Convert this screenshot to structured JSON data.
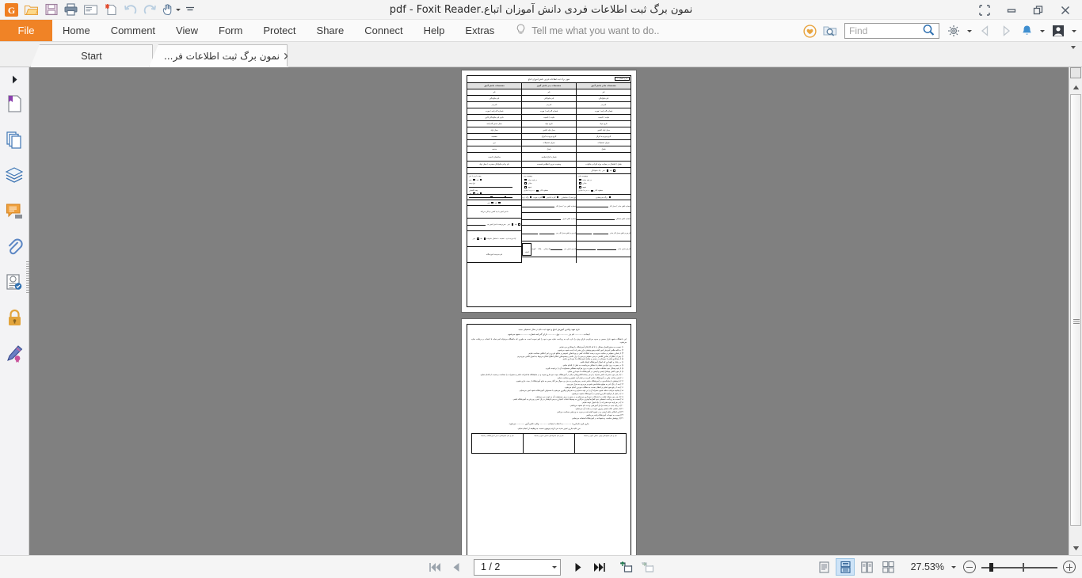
{
  "window": {
    "title": "نمون برگ ثبت اطلاعات فردی دانش آموزان اتباع.pdf - Foxit Reader",
    "controls": {
      "fullscreen": "fullscreen-icon",
      "minimize": "minimize-icon",
      "restore": "restore-icon",
      "close": "close-icon"
    }
  },
  "quick_access": [
    {
      "name": "foxit-logo",
      "label": "Foxit"
    },
    {
      "name": "open-file",
      "label": "Open"
    },
    {
      "name": "save-file",
      "label": "Save"
    },
    {
      "name": "print",
      "label": "Print"
    },
    {
      "name": "email",
      "label": "Email"
    },
    {
      "name": "new-from-scan",
      "label": "Create PDF"
    },
    {
      "name": "undo",
      "label": "Undo"
    },
    {
      "name": "redo",
      "label": "Redo"
    },
    {
      "name": "hand-tool",
      "label": "Hand Tool"
    },
    {
      "name": "customize-toolbar",
      "label": "Customize"
    }
  ],
  "menu": {
    "file_label": "File",
    "items": [
      "Home",
      "Comment",
      "View",
      "Form",
      "Protect",
      "Share",
      "Connect",
      "Help",
      "Extras"
    ],
    "tell_me": "Tell me what you want to do..",
    "right_tools": [
      {
        "name": "heart-icon",
        "label": "Favorites"
      },
      {
        "name": "folder-search-icon",
        "label": "Search Folder"
      }
    ],
    "find": {
      "value": "",
      "placeholder": "Find"
    },
    "settings_label": "Settings",
    "back_label": "Back",
    "forward_label": "Forward",
    "notifications_label": "Notifications",
    "account_label": "Account"
  },
  "tabs": [
    {
      "label": "Start",
      "active": false,
      "closable": false
    },
    {
      "label": "نمون برگ ثبت اطلاعات فر...",
      "active": true,
      "closable": true
    }
  ],
  "left_panel": {
    "expand_label": "Expand Panel",
    "items": [
      {
        "name": "bookmarks-icon",
        "label": "Bookmarks"
      },
      {
        "name": "page-thumbnails-icon",
        "label": "Page Thumbnails"
      },
      {
        "name": "layers-icon",
        "label": "Layers"
      },
      {
        "name": "comments-icon",
        "label": "Comments"
      },
      {
        "name": "attachments-icon",
        "label": "Attachments"
      },
      {
        "name": "stamps-icon",
        "label": "Stamps"
      },
      {
        "name": "security-icon",
        "label": "Security"
      },
      {
        "name": "digital-signature-icon",
        "label": "Digital Signatures"
      }
    ]
  },
  "document": {
    "page1": {
      "form_title": "نمون برگ ثبت اطلاعات فردی دانش آموزان اتباع",
      "form_badge": "فرم شماره ۱",
      "column_headers": [
        "مشخصات مادر دانش آموز",
        "مشخصات پدر دانش آموز",
        "مشخصات دانش آموز"
      ],
      "rows": [
        [
          "نام",
          "نام",
          "نام"
        ],
        [
          "نام خانوادگی",
          "نام خانوادگی",
          "نام خانوادگی"
        ],
        [
          "نام پدر",
          "نام پدر",
          "نام پدر"
        ],
        [
          "شماره گذرنامه / هویت",
          "شماره گذرنامه / هویت",
          "شماره گذرنامه / هویت"
        ],
        [
          "ملیت / تابعیت",
          "ملیت / تابعیت",
          "نام و نام خانوادگی لاتین"
        ],
        [
          "تاریخ تولد",
          "تاریخ تولد",
          "محل صدور گذرنامه"
        ],
        [
          "محل تولد کشور",
          "محل تولد کشور",
          "محل تولد"
        ],
        [
          "تاریخ ورود به ایران",
          "تاریخ ورود به ایران",
          "جنسیت"
        ],
        [
          "میزان تحصیلات",
          "میزان تحصیلات",
          "دین"
        ],
        [
          "شغل",
          "شغل",
          "مذهب"
        ],
        [
          "",
          "شماره اتباع شناسه",
          "ساختمان تابعیت"
        ]
      ],
      "extra_rows": [
        "شغل / اشتغال در حمایت ویژه افراد و خانواده",
        "وضعیت نیروی انتظامی قسمت",
        "نام و نام خانوادگی حضرت / محل تولد"
      ],
      "checkbox_groups": [
        {
          "label": "بیمه داری یا خیر",
          "options": [
            "بله",
            "خیر"
          ]
        },
        {
          "label": "نوع بیمه",
          "options": []
        },
        {
          "label": "بیمه تکمیلی",
          "options": [
            "بله",
            "خیر"
          ]
        },
        {
          "label": "وضعیت پدر",
          "options": [
            "در قید حیات",
            "حیاتی",
            "شهید",
            "مفقود الاثر"
          ]
        },
        {
          "label": "وضعیت مادر",
          "options": [
            "در قید حیات",
            "حیاتی",
            "شهید",
            "مفقود الاثر"
          ]
        },
        {
          "label": "نوع مدرک شناسایی",
          "options": [
            "کارت آمایش",
            "کارت هویت",
            "برگه تردد",
            "کارت اقامت",
            "برگه سرشماری"
          ]
        },
        {
          "label": "راست دست / چپ دست",
          "options": [
            "راست دست",
            "چپ دست"
          ]
        },
        {
          "label": "آیا تاکنون اظهار کرده‌اید",
          "options": [
            "بله",
            "خیر"
          ]
        },
        {
          "label": "دانش آموز با چه کسی زندگی می‌کند",
          "options": []
        },
        {
          "label": "سرپرست دانش آموز پدر",
          "options": [
            "بله",
            "خیر"
          ]
        },
        {
          "label": "آیا فرزند دارد - نسبت - اشتغال خانواده",
          "options": [
            "بله",
            "خیر"
          ]
        }
      ],
      "phone_fields": [
        "شماره تلفن پدر / محل کار",
        "شماره تلفن مادر / محل کار",
        "شماره تلفن منزل",
        "شماره تلفن مسکن",
        "آدرس و تلفن محل کار پدر",
        "آدرس و تلفن محل کار مادر"
      ],
      "address_fields": [
        "آدرس منزل مادر",
        "آدرس منزل پدر",
        "تلفن اصلی",
        "تلفن ثابت",
        "کد پستی",
        "پلاک",
        "کوچه",
        "خیابان"
      ],
      "button_label": "کمیته"
    },
    "page2": {
      "heading": "فرم تعهد والدین آموزش اتباع و تعهد ثبت نام در سال تحصیلی جدید",
      "fields_line": "اینجانب ............ نام پدر ............ نوع ............ دارای گذرنامه شماره ............ متعهد می‌شوم",
      "intro": "این دانشگاه متعهد قرار حسین و حدود می‌کردم دارای ویژه را دارد باید به پرداخت نماید مورد خود را لغو نموده است به طوری که دانشگاه می‌تواند لغو نماید با انتخاب و دریافت نماید می‌شود.",
      "list": [
        "۱) نسبت به دستورالعمل مسائل را با که کارکنان آموزشگاه را همکاری می نمایم.",
        "۲) به کلیه ظاهر آموزش امور گفته وضع پوشش برای مقررات آینده متعهد می‌شوم.",
        "۳) از شادی حقوقی و حمایت حریم درست امکانات کمی و رویدادهای عمومی و منافع فردی و غیر اخلاقی ممانعت نمایم.",
        "۴) پس از اطلاع از شادی کلاسی درسی حقوقی درسی را ترک نکنم و رهنمودهای امکان اطلاع امکان مربوط به اصول کلاس می‌پذیرم.",
        "۵) از همکاری قشر با دوستان در مسیر و مقابل آموزشگاه ما خودداری نمایم.",
        "۶) در رفتار و نگهداری که اموال آموزشگاه کوشا باشم.",
        "۷) در صورت بروز عوارض شماره احتمالی می‌بایست به عمل از اقدام نمایم.",
        "۸) از قید وسائل خود حفاظت نمایم در صورت بروز هرگونه مشکلی مسئولیت آن را برعهده بگیرم.",
        "۹) از مورد گفتن وسائل ایمنی و ایمنی در آموزشگاه ما خودداری نمایم.",
        "۱۰) از هر مورد مقررات تلفن همراه را و هر رسانه الکترونیکی دیگر در آموزشگاه جهت خودداری نموده و در نمایشگاه ها شرکت نکنم و دستورات را ممانعت و نسبت از اقدام نمایم.",
        "۱۱) پاس ساعت های در آموزشگاه حاضر گردیده و تمام آینه عشوری ممانعت نمایم.",
        "۱۲) با پوشش با ساماندهی در آموزشگاه حاضر شده و می‌نمایم و به حق بی سوال هر آغاز سعی به مانع آموزشگاه از حیث خارج نشوم.",
        "۱۳) بعد از زنگ آخر به موقع ساماندهی شوم و می‌روم به منزل می‌روم.",
        "۱۴) بعد از رفع هیچ عملی و اخطار نسبت به مطالب موردی انجام می‌شود.",
        "۱۵) چنانچه مرتکب تخلف شوم، همراه آن را بر عهده نمایم و به شرطی پیگیری می‌شود با مسئولین آموزشگاه متعهد امور می‌نمایم.",
        "۱۶) در قبل از هرگونه کاربری ایمنی در آموزشگاه متعهد می‌شوم.",
        "۱۷) از هر جور سوال تقلب در امتحانات خودداری می‌نمایم و در صورت بروز مسئولیت آن به عهده من می‌باشد.",
        "۱۸) نسبت به پرداخت تحصیلی خود کمک‌ها بهترین مراکزی به وسیله انتخاب اختیاری درسی کوشاتر در یک عمر و ورزش به آموزشگاه باشم.",
        "۱۹) در هر پایه خود مقررات را باید قبول توجه نمایم.",
        "۲۰) در پایه جدید در همه مراحل آموزشی و ثبت نام متعهد می‌باشم.",
        "۲۱) از تمامی نکات ایمنی پیروی نموده و رعایت آن می‌نمایم.",
        "۲۲) این امکانی باشد ایمنی و در شیوه گفته شده و مورد به ورزشی ممانعت می‌کنم.",
        "۲۳) نسبت به تعهدات آموزشگاه پایبند می‌باشم.",
        "۲۴) از پوشش مناسب و متعهدانه در آموزشگاه استفاده می‌نمایم."
      ],
      "footer_line": "جاری فرم نام فرزند ............ به انتخاب اینجانب ............ والی دانش آموز ............ می‌شود.",
      "footer_line2": "من علیه جاری تغییر حدید می کردم توجهی نسبت به وظیفه از انجام نمایم.",
      "signature_columns": [
        "نام و نام خانوادگی ولی دانش آموز و امضا",
        "نام و نام خانوادگی دانش آموز و امضا",
        "نام و نام خانوادگی مدیر آموزشگاه و امضا"
      ]
    }
  },
  "statusbar": {
    "first_page_label": "First Page",
    "prev_page_label": "Previous Page",
    "page_value": "1 / 2",
    "next_page_label": "Next Page",
    "last_page_label": "Last Page",
    "previous_view_label": "Previous View",
    "next_view_label": "Next View",
    "view_modes": [
      {
        "name": "single-page-mode",
        "label": "Single Page",
        "active": false
      },
      {
        "name": "continuous-scroll-mode",
        "label": "Continuous",
        "active": true
      },
      {
        "name": "facing-mode",
        "label": "Facing",
        "active": false
      },
      {
        "name": "continuous-facing-mode",
        "label": "Continuous Facing",
        "active": false
      }
    ],
    "zoom_value": "27.53%",
    "zoom_out_label": "Zoom Out",
    "zoom_in_label": "Zoom In"
  },
  "colors": {
    "accent": "#f08326",
    "menu_bg": "#fafafa",
    "viewport_bg": "#808080",
    "tab_active": "#fdfdfd"
  }
}
